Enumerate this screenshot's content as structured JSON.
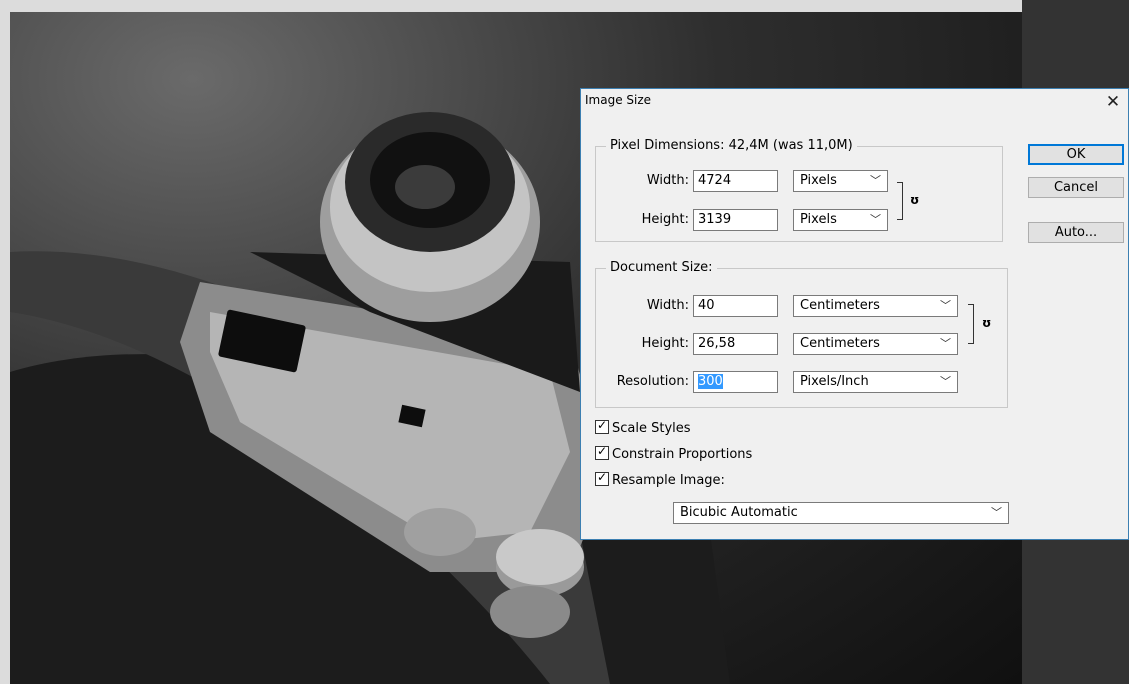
{
  "dialog": {
    "title": "Image Size",
    "pixel_dimensions": {
      "label": "Pixel Dimensions:  42,4M (was 11,0M)",
      "width_label": "Width:",
      "width_value": "4724",
      "width_unit": "Pixels",
      "height_label": "Height:",
      "height_value": "3139",
      "height_unit": "Pixels"
    },
    "document_size": {
      "label": "Document Size:",
      "width_label": "Width:",
      "width_value": "40",
      "width_unit": "Centimeters",
      "height_label": "Height:",
      "height_value": "26,58",
      "height_unit": "Centimeters",
      "resolution_label": "Resolution:",
      "resolution_value": "300",
      "resolution_unit": "Pixels/Inch"
    },
    "options": {
      "scale_styles": "Scale Styles",
      "constrain_proportions": "Constrain Proportions",
      "resample_image": "Resample Image:",
      "resample_method": "Bicubic Automatic"
    },
    "buttons": {
      "ok": "OK",
      "cancel": "Cancel",
      "auto": "Auto..."
    }
  },
  "icons": {
    "close": "close-icon",
    "link": "link-chain-icon",
    "chevron": "chevron-down-icon",
    "check": "checkmark-icon"
  }
}
